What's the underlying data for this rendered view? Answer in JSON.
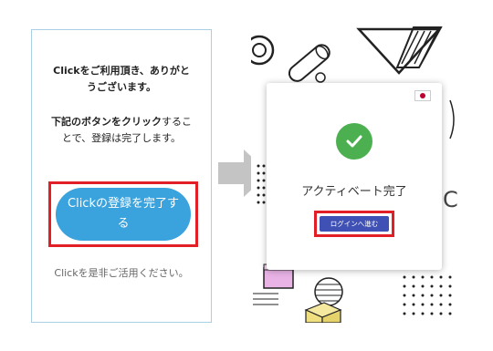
{
  "email": {
    "heading": "Clickをご利用頂き、ありがとうございます。",
    "instruction_bold": "下記のボタンをクリック",
    "instruction_rest": "することで、登録は完了します。",
    "button_label": "Clickの登録を完了する",
    "footer": "Clickを是非ご活用ください。"
  },
  "app": {
    "modal_title": "アクティベート完了",
    "login_button": "ログインへ進む",
    "background_letter": "C",
    "flag_icon": "japan-flag-icon"
  },
  "colors": {
    "cta_blue": "#3aa2dc",
    "highlight_red": "#e21f26",
    "success_green": "#4caf50",
    "login_indigo": "#3f51b5"
  }
}
